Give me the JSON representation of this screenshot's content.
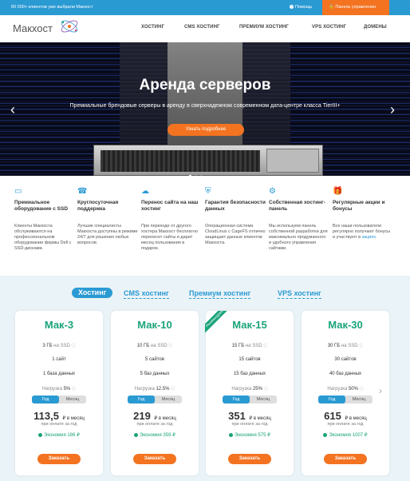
{
  "topbar": {
    "clients_text": "60 000+ клиентов уже выбрали Макхост",
    "help": "Помощь",
    "panel": "Панель управления"
  },
  "header": {
    "logo": "Макхост",
    "nav": [
      "ХОСТИНГ",
      "CMS ХОСТИНГ",
      "ПРЕМИУМ ХОСТИНГ",
      "VPS ХОСТИНГ",
      "ДОМЕНЫ"
    ]
  },
  "hero": {
    "title": "Аренда серверов",
    "subtitle": "Премиальные брендовые серверы в аренду в сверхнадежном современном дата-центре класса TierIII+",
    "button": "Узнать подробнее",
    "prev_icon": "chevron-left-icon",
    "next_icon": "chevron-right-icon"
  },
  "features": [
    {
      "icon": "ssd-icon",
      "title": "Премиальное оборудование с SSD",
      "text": "Клиенты Макхоста обслуживаются на профессиональном оборудовании фирмы Dell с SSD-дисками."
    },
    {
      "icon": "support-icon",
      "title": "Круглосуточная поддержка",
      "text": "Лучшие специалисты Макхоста доступны в режиме 24/7 для решения любых вопросов."
    },
    {
      "icon": "cloud-transfer-icon",
      "title": "Перенос сайта на наш хостинг",
      "text": "При переходе от другого хостера Макхост бесплатно перенесет сайты и дарит месяц пользования в подарок."
    },
    {
      "icon": "shield-icon",
      "title": "Гарантия безопасности данных",
      "text": "Операционная система CloudLinux с CageFS отлично защищает данные клиентов Макхоста."
    },
    {
      "icon": "panel-icon",
      "title": "Собственная хостинг-панель",
      "text": "Мы используем панель собственной разработки для максимально продуманного и удобного управления сайтами."
    },
    {
      "icon": "gift-icon",
      "title": "Регулярные акции и бонусы",
      "text": "Все наши пользователи регулярно получают бонусы и участвуют в ",
      "link": "акциях."
    }
  ],
  "tabs": [
    "Хостинг",
    "CMS хостинг",
    "Премиум хостинг",
    "VPS хостинг"
  ],
  "ribbon": "Рекомендуем",
  "billing": {
    "year": "Год",
    "month": "Месяц"
  },
  "plans": [
    {
      "name": "Мак-3",
      "disk_value": "3 ГБ",
      "disk_unit": "на SSD",
      "sites_value": "1 сайт",
      "db_value": "1 база данных",
      "load_label": "Нагрузка",
      "load_value": "5%",
      "price_value": "113,5",
      "price_unit": "₽ в месяц",
      "price_note": "при оплате за год",
      "save_label": "Экономия 186 ₽",
      "order_label": "Заказать"
    },
    {
      "name": "Мак-10",
      "disk_value": "10 ГБ",
      "disk_unit": "на SSD",
      "sites_value": "5 сайтов",
      "db_value": "5 баз данных",
      "load_label": "Нагрузка",
      "load_value": "12.5%",
      "price_value": "219",
      "price_unit": "₽ в месяц",
      "price_note": "при оплате за год",
      "save_label": "Экономия 359 ₽",
      "order_label": "Заказать"
    },
    {
      "name": "Мак-15",
      "disk_value": "15 ГБ",
      "disk_unit": "на SSD",
      "sites_value": "15 сайтов",
      "db_value": "15 баз данных",
      "load_label": "Нагрузка",
      "load_value": "25%",
      "price_value": "351",
      "price_unit": "₽ в месяц",
      "price_note": "при оплате за год",
      "save_label": "Экономия 575 ₽",
      "order_label": "Заказать"
    },
    {
      "name": "Мак-30",
      "disk_value": "30 ГБ",
      "disk_unit": "на SSD",
      "sites_value": "30 сайтов",
      "db_value": "40 баз данных",
      "load_label": "Нагрузка",
      "load_value": "50%",
      "price_value": "615",
      "price_unit": "₽ в месяц",
      "price_note": "при оплате за год",
      "save_label": "Экономия 1007 ₽",
      "order_label": "Заказать"
    }
  ],
  "colors": {
    "primary": "#2a9ad3",
    "accent": "#f37321",
    "green": "#1aa37a"
  }
}
